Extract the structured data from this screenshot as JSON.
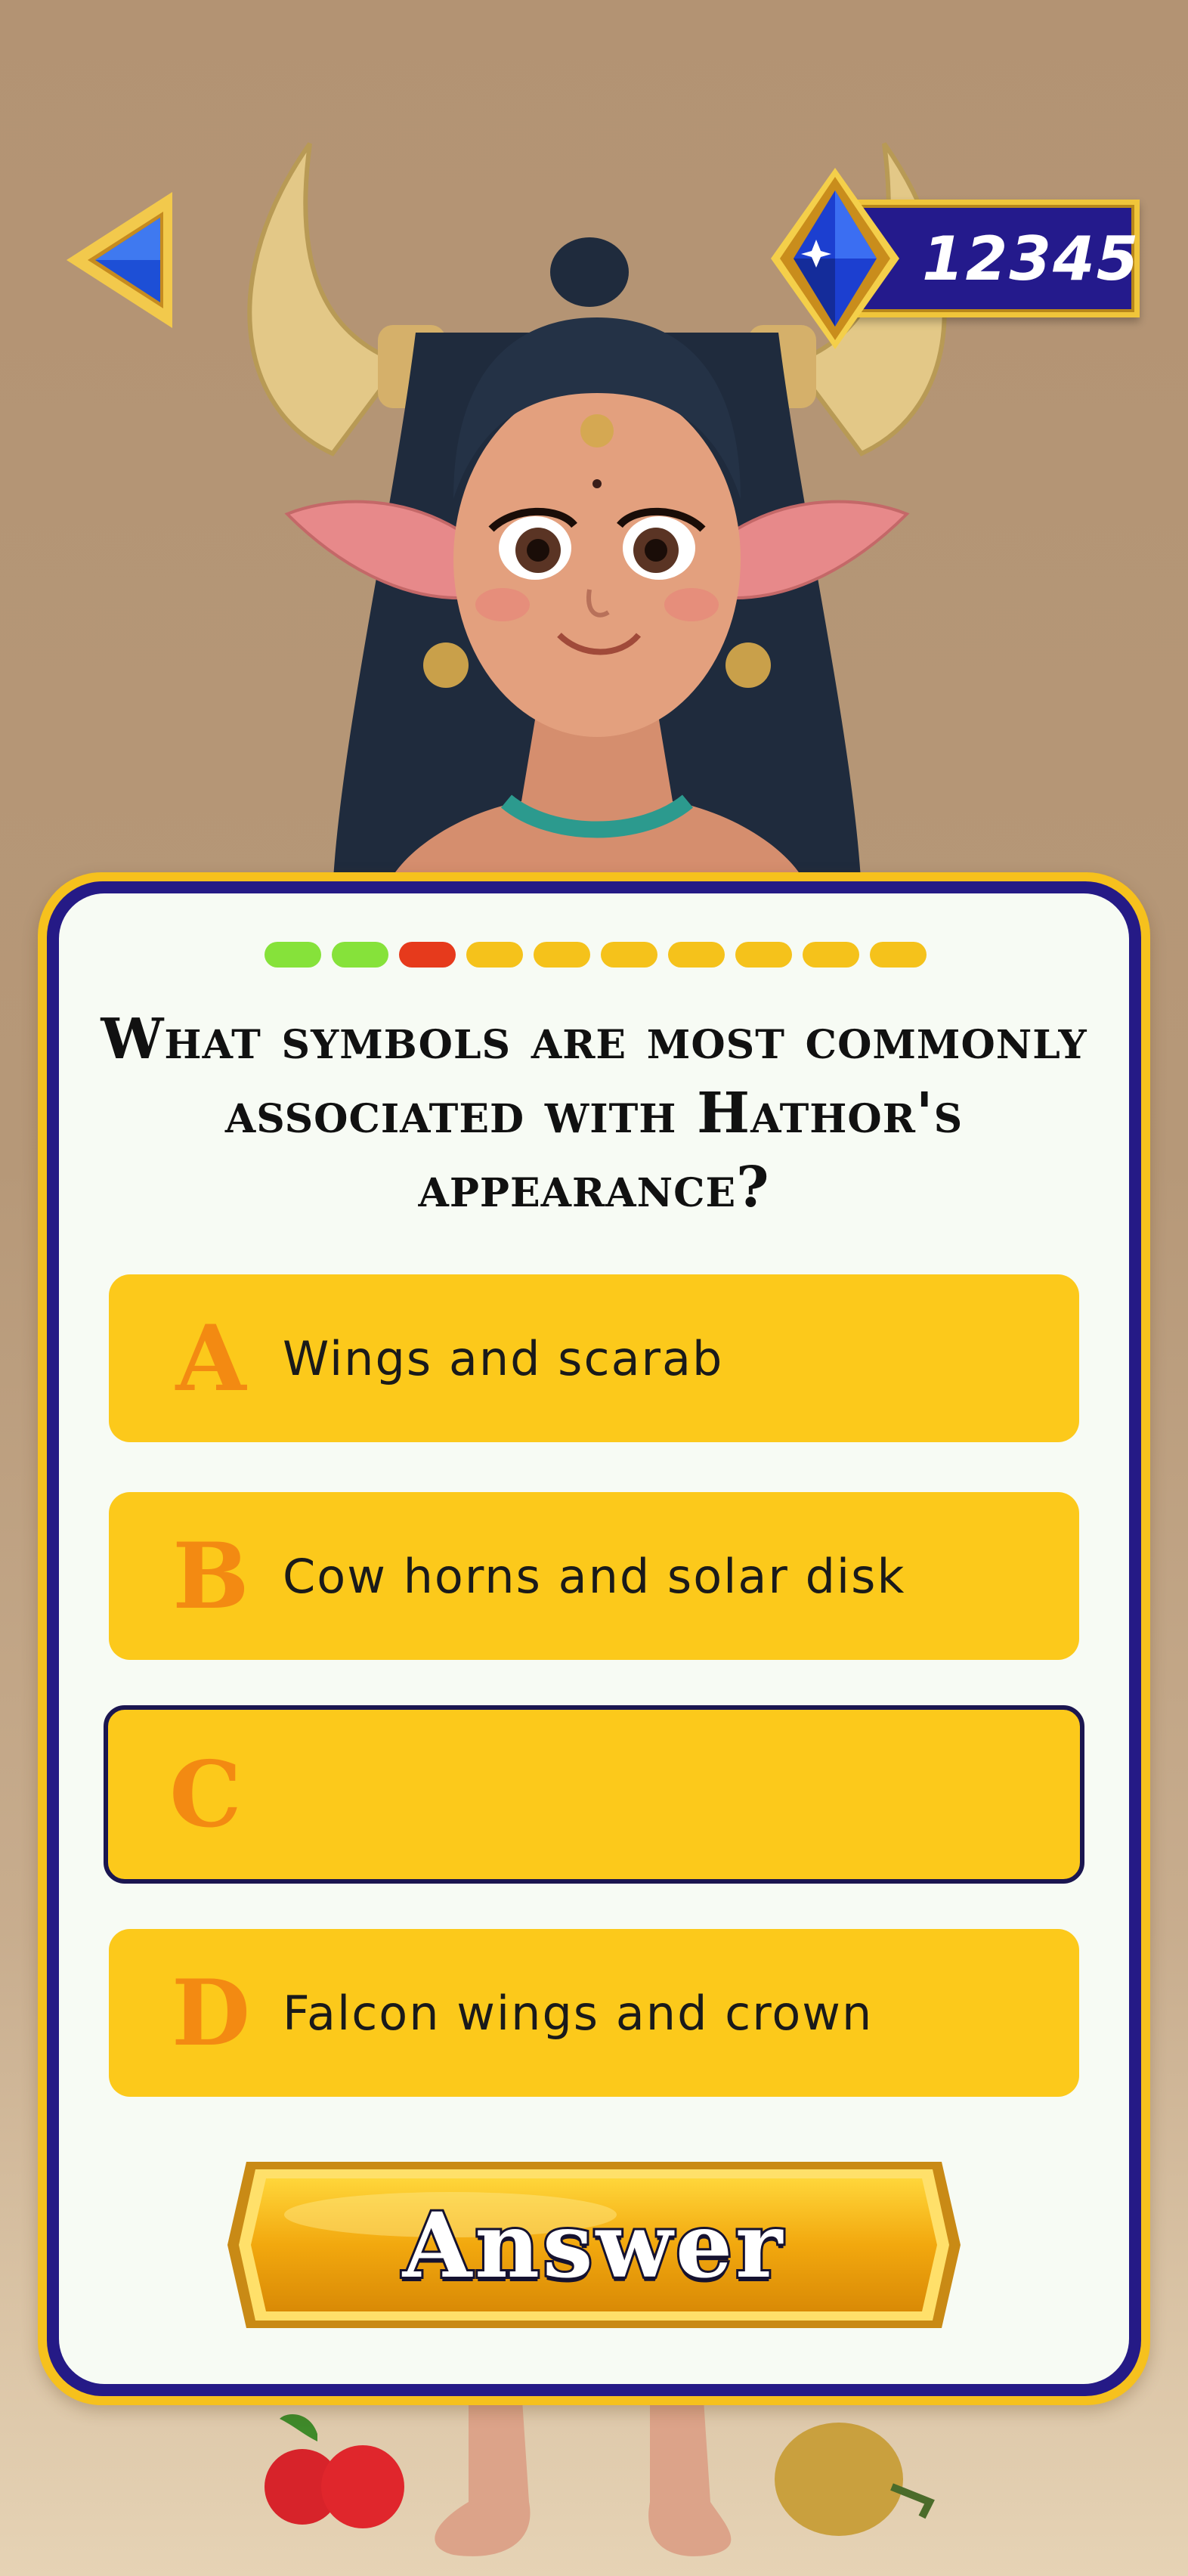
{
  "header": {
    "back_icon": "back-arrow-icon",
    "gem_icon": "blue-diamond-icon",
    "score": "12345"
  },
  "quiz": {
    "progress": [
      "green",
      "green",
      "red",
      "yellow",
      "yellow",
      "yellow",
      "yellow",
      "yellow",
      "yellow",
      "yellow"
    ],
    "progress_colors": {
      "green": "#86e23a",
      "red": "#e63a1c",
      "yellow": "#f5c21b"
    },
    "question": "What symbols are most commonly associated with Hathor's appearance?",
    "options": [
      {
        "letter": "A",
        "text": "Wings and scarab"
      },
      {
        "letter": "B",
        "text": "Cow horns and solar disk"
      },
      {
        "letter": "C",
        "text": ""
      },
      {
        "letter": "D",
        "text": "Falcon wings and crown"
      }
    ],
    "selected_option": "C",
    "answer_label": "Answer"
  },
  "colors": {
    "card_border_gold": "#f6c11d",
    "card_border_navy": "#251a86",
    "option_fill": "#fcc91b",
    "option_letter": "#f38a12"
  }
}
